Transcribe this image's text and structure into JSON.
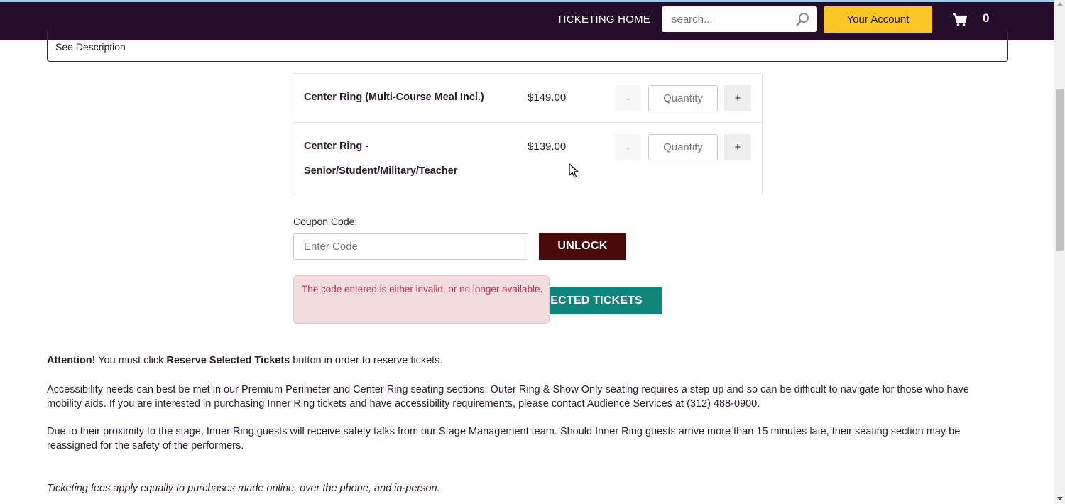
{
  "header": {
    "nav_home": "TICKETING HOME",
    "search_placeholder": "search...",
    "account_label": "Your Account",
    "cart_count": "0"
  },
  "description": {
    "label": "See Description"
  },
  "tickets": [
    {
      "name_lines": [
        "Center Ring (Multi-Course Meal Incl.)"
      ],
      "price": "$149.00",
      "minus": "-",
      "quantity_placeholder": "Quantity",
      "plus": "+"
    },
    {
      "name_lines": [
        "Center Ring -",
        "Senior/Student/Military/Teacher"
      ],
      "price": "$139.00",
      "minus": "-",
      "quantity_placeholder": "Quantity",
      "plus": "+"
    }
  ],
  "coupon": {
    "label": "Coupon Code:",
    "placeholder": "Enter Code",
    "unlock_label": "UNLOCK",
    "error": "The code entered is either invalid, or no longer available."
  },
  "reserve_button": "LECTED TICKETS",
  "info": {
    "attention_strong": "Attention!",
    "attention_pre": " You must click ",
    "attention_button": "Reserve Selected Tickets",
    "attention_post": " button in order to reserve tickets.",
    "accessibility": "Accessibility needs can best be met in our Premium Perimeter and Center Ring seating sections. Outer Ring & Show Only seating requires a step up and so can be difficult to navigate for those who have mobility aids. If you are interested in purchasing Inner Ring tickets and have accessibility requirements, please contact Audience Services at (312) 488-0900.",
    "safety": "Due to their proximity to the stage, Inner Ring guests will receive safety talks from our Stage Management team. Should Inner Ring guests arrive more than 15 minutes late, their seating section may be reassigned for the safety of the performers.",
    "fees": "Ticketing fees apply equally to purchases made online, over the phone, and in-person."
  },
  "colors": {
    "navbar": "#250c2a",
    "account_button": "#f9c624",
    "unlock_button": "#4a0a0a",
    "reserve_button": "#10857a",
    "error_bg": "#f3dcdd",
    "error_text": "#c0304a"
  },
  "icons": {
    "search": "search-icon",
    "cart": "cart-icon",
    "cursor": "mouse-cursor-icon"
  }
}
